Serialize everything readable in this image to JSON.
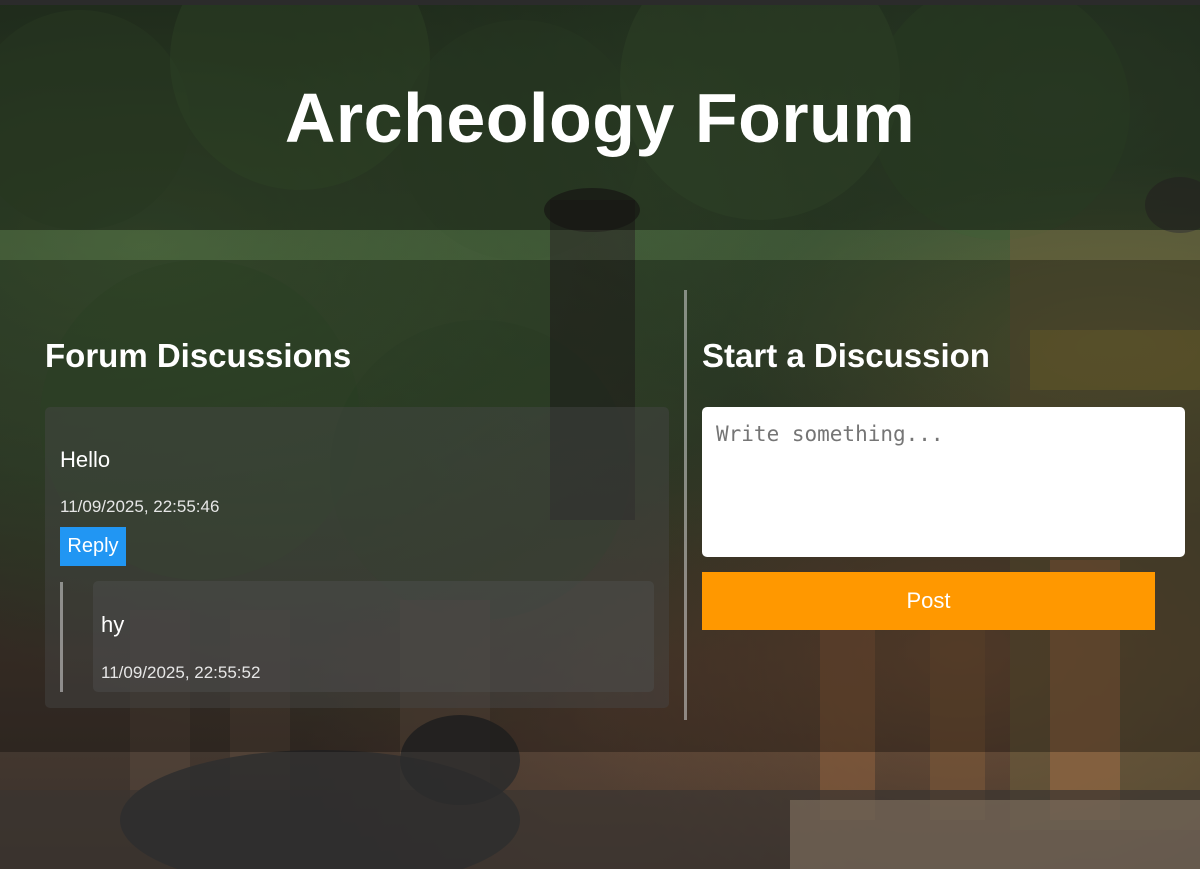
{
  "header": {
    "title": "Archeology Forum"
  },
  "forum": {
    "heading": "Forum Discussions",
    "posts": [
      {
        "text": "Hello",
        "timestamp": "11/09/2025, 22:55:46",
        "reply_label": "Reply",
        "replies": [
          {
            "text": "hy",
            "timestamp": "11/09/2025, 22:55:52"
          }
        ]
      }
    ]
  },
  "compose": {
    "heading": "Start a Discussion",
    "placeholder": "Write something...",
    "post_label": "Post"
  },
  "colors": {
    "reply_button": "#2196f3",
    "post_button": "#ff9800",
    "header_text": "#ffffff"
  }
}
